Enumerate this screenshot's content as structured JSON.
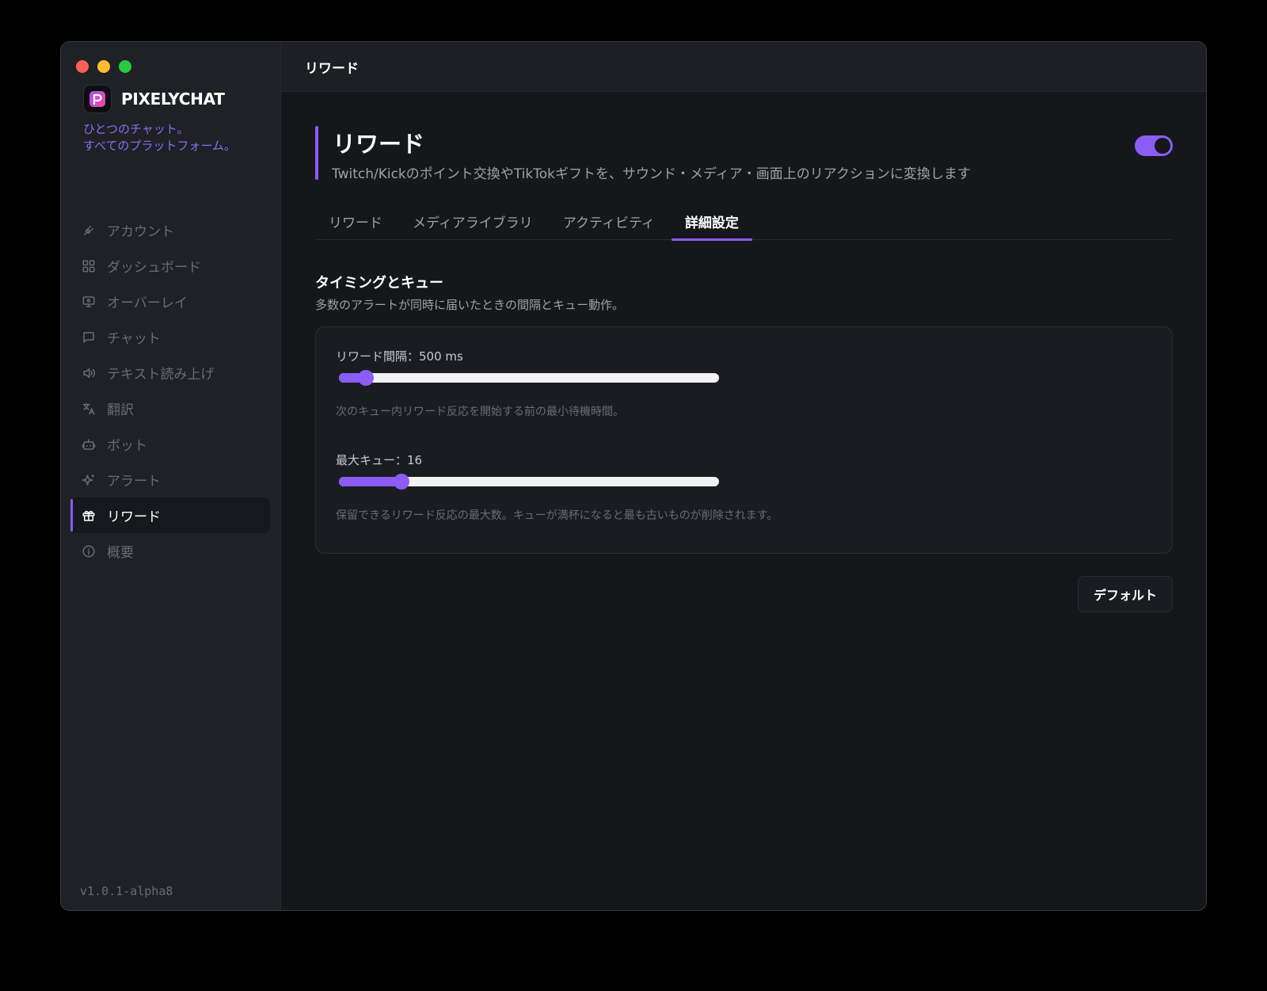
{
  "window": {
    "traffic_lights": [
      "close",
      "minimize",
      "zoom"
    ]
  },
  "sidebar": {
    "brand_name": "PIXELYCHAT",
    "tagline_line1": "ひとつのチャット。",
    "tagline_line2": "すべてのプラットフォーム。",
    "items": [
      {
        "label": "アカウント",
        "icon": "plug-icon"
      },
      {
        "label": "ダッシュボード",
        "icon": "grid-icon"
      },
      {
        "label": "オーバーレイ",
        "icon": "monitor-icon"
      },
      {
        "label": "チャット",
        "icon": "message-icon"
      },
      {
        "label": "テキスト読み上げ",
        "icon": "speaker-icon"
      },
      {
        "label": "翻訳",
        "icon": "translate-icon"
      },
      {
        "label": "ボット",
        "icon": "bot-icon"
      },
      {
        "label": "アラート",
        "icon": "sparkle-icon"
      },
      {
        "label": "リワード",
        "icon": "gift-icon",
        "active": true
      },
      {
        "label": "概要",
        "icon": "info-icon"
      }
    ],
    "version": "v1.0.1-alpha8"
  },
  "topbar": {
    "title": "リワード"
  },
  "header": {
    "title": "リワード",
    "description": "Twitch/Kickのポイント交換やTikTokギフトを、サウンド・メディア・画面上のリアクションに変換します",
    "enabled": true
  },
  "tabs": [
    {
      "label": "リワード"
    },
    {
      "label": "メディアライブラリ"
    },
    {
      "label": "アクティビティ"
    },
    {
      "label": "詳細設定",
      "active": true
    }
  ],
  "section": {
    "title": "タイミングとキュー",
    "description": "多数のアラートが同時に届いたときの間隔とキュー動作。"
  },
  "settings": {
    "interval": {
      "label": "リワード間隔：500 ms",
      "value_fraction": 0.07,
      "help": "次のキュー内リワード反応を開始する前の最小待機時間。"
    },
    "max_queue": {
      "label": "最大キュー：16",
      "value_fraction": 0.165,
      "help": "保留できるリワード反応の最大数。キューが満杯になると最も古いものが削除されます。"
    }
  },
  "buttons": {
    "default_label": "デフォルト"
  },
  "colors": {
    "accent": "#8b5cf6",
    "tagline": "#8b6cf0",
    "background": "#16171b",
    "sidebar": "#202127"
  }
}
